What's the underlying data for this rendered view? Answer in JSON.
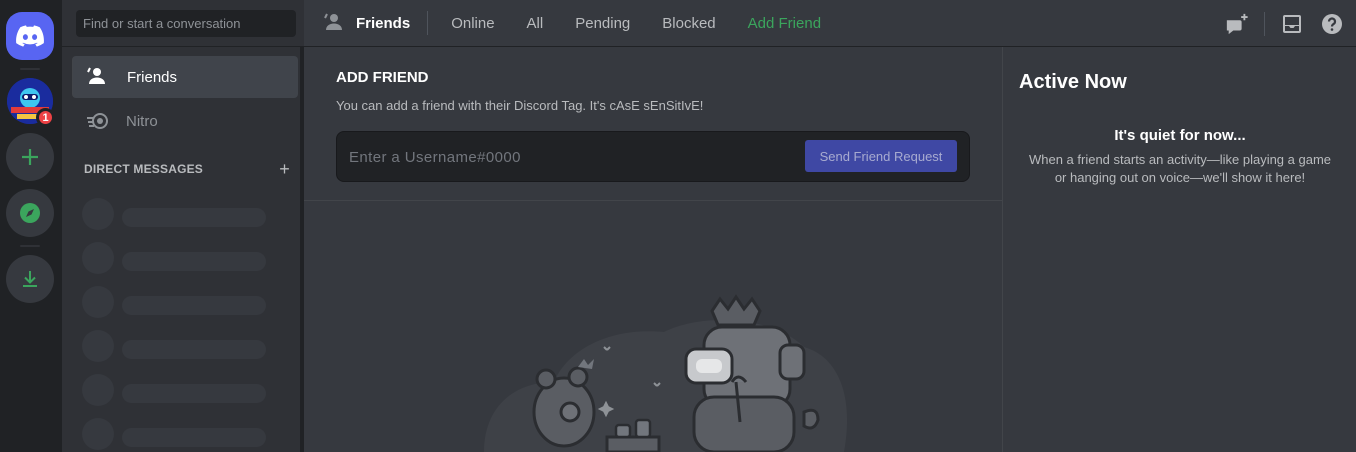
{
  "colors": {
    "brand": "#5865f2",
    "green": "#3ba55d",
    "badge": "#ed4245",
    "rail_bg": "#202225",
    "sidebar_bg": "#2f3136",
    "main_bg": "#36393f"
  },
  "rail": {
    "home_icon": "discord-logo-icon",
    "server": {
      "badge_count": "1",
      "avatar_icon": "server-avatar-icon"
    },
    "add_server_icon": "plus-icon",
    "explore_icon": "compass-icon",
    "download_icon": "download-icon"
  },
  "sidebar": {
    "search_placeholder": "Find or start a conversation",
    "nav": [
      {
        "label": "Friends",
        "icon": "friends-icon"
      },
      {
        "label": "Nitro",
        "icon": "nitro-icon"
      }
    ],
    "dm_header": "DIRECT MESSAGES",
    "dm_add": "+"
  },
  "header": {
    "title": "Friends",
    "tabs": [
      "Online",
      "All",
      "Pending",
      "Blocked",
      "Add Friend"
    ]
  },
  "add_friend": {
    "title": "ADD FRIEND",
    "description": "You can add a friend with their Discord Tag. It's cAsE sEnSitIvE!",
    "input_placeholder": "Enter a Username#0000",
    "button": "Send Friend Request"
  },
  "active_now": {
    "title": "Active Now",
    "empty_title": "It's quiet for now...",
    "empty_desc": "When a friend starts an activity—like playing a game or hanging out on voice—we'll show it here!"
  }
}
